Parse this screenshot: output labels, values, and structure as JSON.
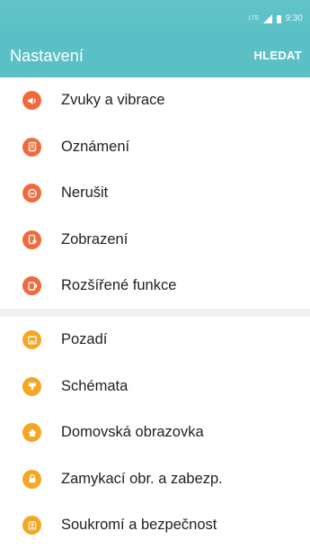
{
  "status_bar": {
    "network": "LTE",
    "time": "9:30"
  },
  "app_bar": {
    "title": "Nastavení",
    "search_label": "HLEDAT"
  },
  "colors": {
    "accent": "#5bc0c6",
    "orange_red": "#f26a3c",
    "orange": "#f5a623"
  },
  "settings_group_1": [
    {
      "label": "Zvuky a vibrace",
      "icon": "speaker-icon"
    },
    {
      "label": "Oznámení",
      "icon": "notification-icon"
    },
    {
      "label": "Nerušit",
      "icon": "do-not-disturb-icon"
    },
    {
      "label": "Zobrazení",
      "icon": "display-icon"
    },
    {
      "label": "Rozšířené funkce",
      "icon": "advanced-features-icon"
    }
  ],
  "settings_group_2": [
    {
      "label": "Pozadí",
      "icon": "wallpaper-icon"
    },
    {
      "label": "Schémata",
      "icon": "themes-icon"
    },
    {
      "label": "Domovská obrazovka",
      "icon": "home-icon"
    },
    {
      "label": "Zamykací obr. a zabezp.",
      "icon": "lock-icon"
    },
    {
      "label": "Soukromí a bezpečnost",
      "icon": "privacy-icon"
    }
  ]
}
